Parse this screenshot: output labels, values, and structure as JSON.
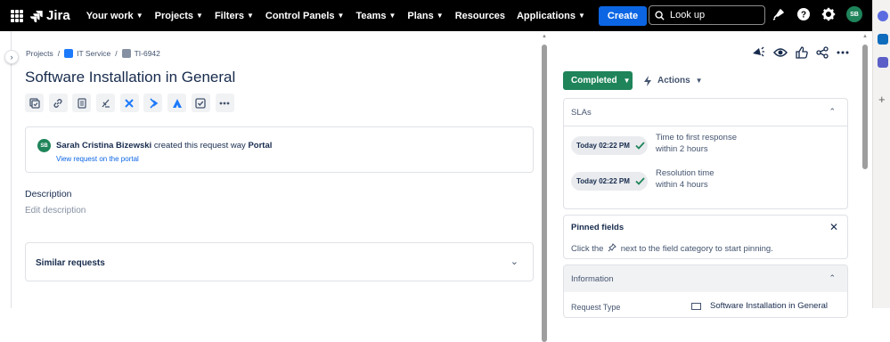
{
  "topbar": {
    "product": "Jira",
    "nav": [
      {
        "label": "Your work",
        "dropdown": true
      },
      {
        "label": "Projects",
        "dropdown": true
      },
      {
        "label": "Filters",
        "dropdown": true
      },
      {
        "label": "Control Panels",
        "dropdown": true
      },
      {
        "label": "Teams",
        "dropdown": true
      },
      {
        "label": "Plans",
        "dropdown": true
      },
      {
        "label": "Resources",
        "dropdown": false
      },
      {
        "label": "Applications",
        "dropdown": true
      }
    ],
    "create_label": "Create",
    "search_placeholder": "Look up",
    "icons": [
      "notifications-icon",
      "help-icon",
      "settings-icon"
    ],
    "avatar_initials": "SB"
  },
  "breadcrumb": {
    "root": "Projects",
    "project": "IT Service",
    "issue_key": "TI-6942"
  },
  "issue": {
    "title": "Software Installation in General",
    "toolbar_icons": [
      "add-child-icon",
      "link-icon",
      "document-icon",
      "branch-icon",
      "integration-icon",
      "integration-alt-icon",
      "atlassian-icon",
      "checklist-icon",
      "more-icon"
    ]
  },
  "activity": {
    "avatar_initials": "SB",
    "user": "Sarah Cristina Bizewski",
    "action": "created this request way",
    "channel": "Portal",
    "link": "View request on the portal"
  },
  "description": {
    "heading": "Description",
    "placeholder": "Edit description"
  },
  "similar": {
    "label": "Similar requests"
  },
  "sidebar": {
    "status": "Completed",
    "actions_label": "Actions",
    "status_color": "#1f845a",
    "slas": {
      "heading": "SLAs",
      "items": [
        {
          "time": "Today 02:22 PM",
          "goal": "Time to first response",
          "within": "within 2 hours"
        },
        {
          "time": "Today 02:22 PM",
          "goal": "Resolution time",
          "within": "within 4 hours"
        }
      ]
    },
    "pinned": {
      "heading": "Pinned fields",
      "hint_before": "Click the",
      "hint_after": "next to the field category to start pinning."
    },
    "information": {
      "heading": "Information",
      "row_label": "Request Type",
      "row_value": "Software Installation in General"
    }
  },
  "colors": {
    "accent": "#0c66e4",
    "success": "#1f845a",
    "topbar": "#000000"
  }
}
